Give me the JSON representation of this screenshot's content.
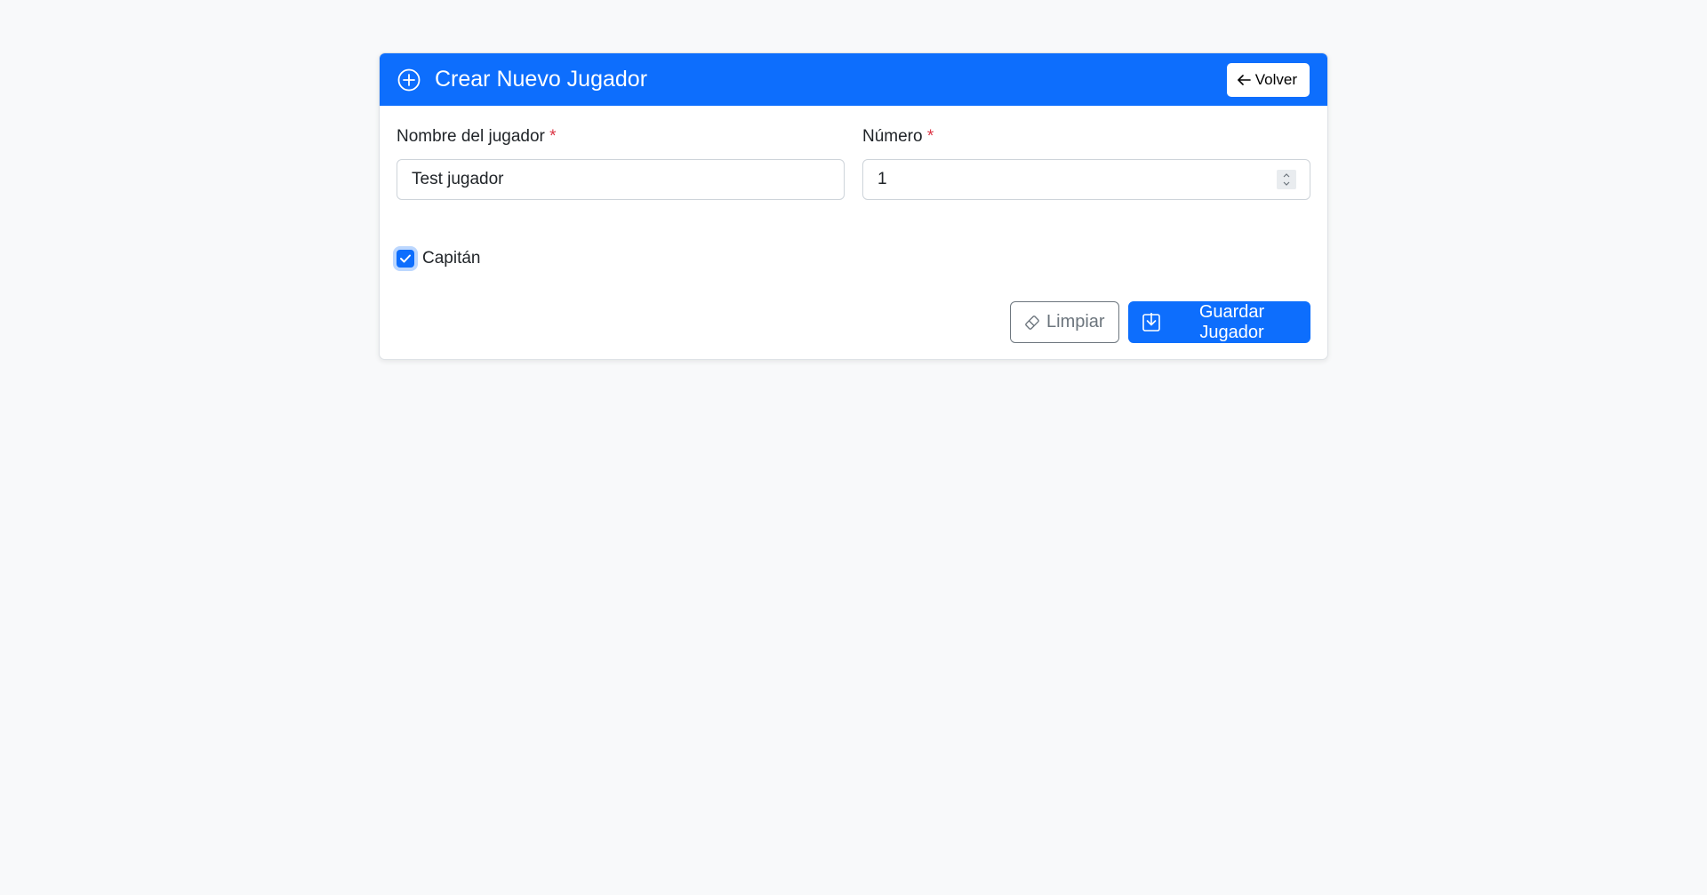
{
  "header": {
    "title": "Crear Nuevo Jugador",
    "title_icon": "plus-circle-icon",
    "back_icon": "arrow-left-icon",
    "back_label": "Volver"
  },
  "form": {
    "name_label": "Nombre del jugador",
    "name_required": "*",
    "name_value": "Test jugador",
    "number_label": "Número",
    "number_required": "*",
    "number_value": "1",
    "captain_label": "Capitán",
    "captain_checked": true
  },
  "actions": {
    "clear_icon": "eraser-icon",
    "clear_label": "Limpiar",
    "save_icon": "save-download-icon",
    "save_label": "Guardar Jugador"
  },
  "colors": {
    "primary": "#0d6efd",
    "required": "#dc3545",
    "secondary": "#6c757d",
    "background": "#f8f9fa"
  }
}
